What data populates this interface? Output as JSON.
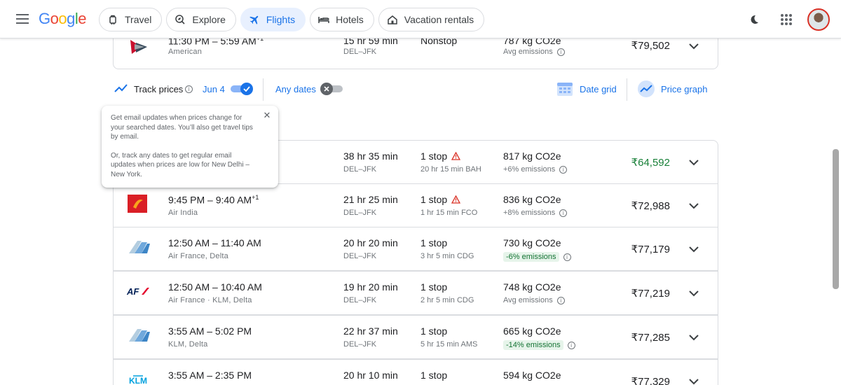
{
  "header": {
    "logo": "Google",
    "nav": [
      {
        "label": "Travel",
        "icon": "luggage-icon",
        "active": false
      },
      {
        "label": "Explore",
        "icon": "explore-icon",
        "active": false
      },
      {
        "label": "Flights",
        "icon": "plane-icon",
        "active": true
      },
      {
        "label": "Hotels",
        "icon": "bed-icon",
        "active": false
      },
      {
        "label": "Vacation rentals",
        "icon": "house-icon",
        "active": false
      }
    ]
  },
  "track_bar": {
    "label": "Track prices",
    "date": "Jun 4",
    "any_dates": "Any dates",
    "date_grid": "Date grid",
    "price_graph": "Price graph"
  },
  "tooltip": {
    "para1": "Get email updates when prices change for your searched dates. You’ll also get travel tips by email.",
    "para2": "Or, track any dates to get regular email updates when prices are low for New Delhi – New York.",
    "close": "✕"
  },
  "flights": [
    {
      "times": "11:30 PM – 5:59 AM",
      "plus": "+1",
      "airline": "American",
      "duration": "15 hr 59 min",
      "route": "DEL–JFK",
      "stops": "Nonstop",
      "stop_detail": "",
      "co2": "787 kg CO2e",
      "emissions": "Avg emissions",
      "price": "₹79,502"
    },
    {
      "times": "",
      "plus": "",
      "airline": "",
      "duration": "38 hr 35 min",
      "route": "DEL–JFK",
      "stops": "1 stop",
      "stop_detail": "20 hr 15 min BAH",
      "co2": "817 kg CO2e",
      "emissions": "+6% emissions",
      "price": "₹64,592"
    },
    {
      "times": "9:45 PM – 9:40 AM",
      "plus": "+1",
      "airline": "Air India",
      "duration": "21 hr 25 min",
      "route": "DEL–JFK",
      "stops": "1 stop",
      "stop_detail": "1 hr 15 min FCO",
      "co2": "836 kg CO2e",
      "emissions": "+8% emissions",
      "price": "₹72,988"
    },
    {
      "times": "12:50 AM – 11:40 AM",
      "plus": "",
      "airline": "Air France, Delta",
      "duration": "20 hr 20 min",
      "route": "DEL–JFK",
      "stops": "1 stop",
      "stop_detail": "3 hr 5 min CDG",
      "co2": "730 kg CO2e",
      "emissions": "-6% emissions",
      "price": "₹77,179"
    },
    {
      "times": "12:50 AM – 10:40 AM",
      "plus": "",
      "airline": "Air France · KLM, Delta",
      "duration": "19 hr 20 min",
      "route": "DEL–JFK",
      "stops": "1 stop",
      "stop_detail": "2 hr 5 min CDG",
      "co2": "748 kg CO2e",
      "emissions": "Avg emissions",
      "price": "₹77,219"
    },
    {
      "times": "3:55 AM – 5:02 PM",
      "plus": "",
      "airline": "KLM, Delta",
      "duration": "22 hr 37 min",
      "route": "DEL–JFK",
      "stops": "1 stop",
      "stop_detail": "5 hr 15 min AMS",
      "co2": "665 kg CO2e",
      "emissions": "-14% emissions",
      "price": "₹77,285"
    },
    {
      "times": "3:55 AM – 2:35 PM",
      "plus": "",
      "airline": "",
      "duration": "20 hr 10 min",
      "route": "",
      "stops": "1 stop",
      "stop_detail": "",
      "co2": "594 kg CO2e",
      "emissions": "",
      "price": "₹77,329"
    }
  ],
  "airline_logos": {
    "klm_text": "KLM",
    "af_text": "AF"
  },
  "colors": {
    "accent": "#1a73e8",
    "best_price": "#188038",
    "warning": "#d93025",
    "low_emission_bg": "#e6f4ea"
  }
}
